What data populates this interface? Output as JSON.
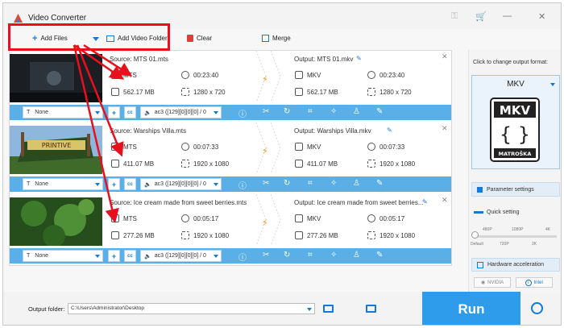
{
  "window": {
    "title": "Video Converter"
  },
  "titlebar": {
    "key_icon": "key-icon",
    "cart_icon": "cart-icon",
    "minimize": "—",
    "close": "✕"
  },
  "toolbar": {
    "add_files": "Add Files",
    "add_folder": "Add Video Folder",
    "clear": "Clear",
    "merge": "Merge"
  },
  "tasks": [
    {
      "source": "Source: MTS 01.mts",
      "output": "Output: MTS 01.mkv",
      "src": {
        "format": "MTS",
        "duration": "00:23:40",
        "size": "562.17 MB",
        "resolution": "1280 x 720"
      },
      "out": {
        "format": "MKV",
        "duration": "00:23:40",
        "size": "562.17 MB",
        "resolution": "1280 x 720"
      },
      "subtitle": "None",
      "audio": "ac3 ([129][0][0][0] / 0"
    },
    {
      "source": "Source: Warships Villa.mts",
      "output": "Output: Warships Villa.mkv",
      "src": {
        "format": "MTS",
        "duration": "00:07:33",
        "size": "411.07 MB",
        "resolution": "1920 x 1080"
      },
      "out": {
        "format": "MKV",
        "duration": "00:07:33",
        "size": "411.07 MB",
        "resolution": "1920 x 1080"
      },
      "subtitle": "None",
      "audio": "ac3 ([129][0][0][0] / 0"
    },
    {
      "source": "Source: Ice cream made from sweet berries.mts",
      "output": "Output: Ice cream made from sweet berries...",
      "src": {
        "format": "MTS",
        "duration": "00:05:17",
        "size": "277.26 MB",
        "resolution": "1920 x 1080"
      },
      "out": {
        "format": "MKV",
        "duration": "00:05:17",
        "size": "277.26 MB",
        "resolution": "1920 x 1080"
      },
      "subtitle": "None",
      "audio": "ac3 ([129][0][0][0] / 0"
    }
  ],
  "right_panel": {
    "hint": "Click to change output format:",
    "format": "MKV",
    "logo_text": "MKV",
    "logo_sub": "MATROŠKA",
    "param_settings": "Parameter settings",
    "quick_setting": "Quick setting",
    "quick_top": [
      "480P",
      "1080P",
      "4K"
    ],
    "quick_bottom": [
      "Default",
      "720P",
      "2K"
    ],
    "quality_level": 0,
    "hw_accel": "Hardware acceleration",
    "gpu_nvidia": "NVIDIA",
    "gpu_intel": "Intel"
  },
  "bottom": {
    "output_folder_label": "Output folder:",
    "output_folder_value": "C:\\Users\\Administrator\\Desktop",
    "run": "Run"
  }
}
